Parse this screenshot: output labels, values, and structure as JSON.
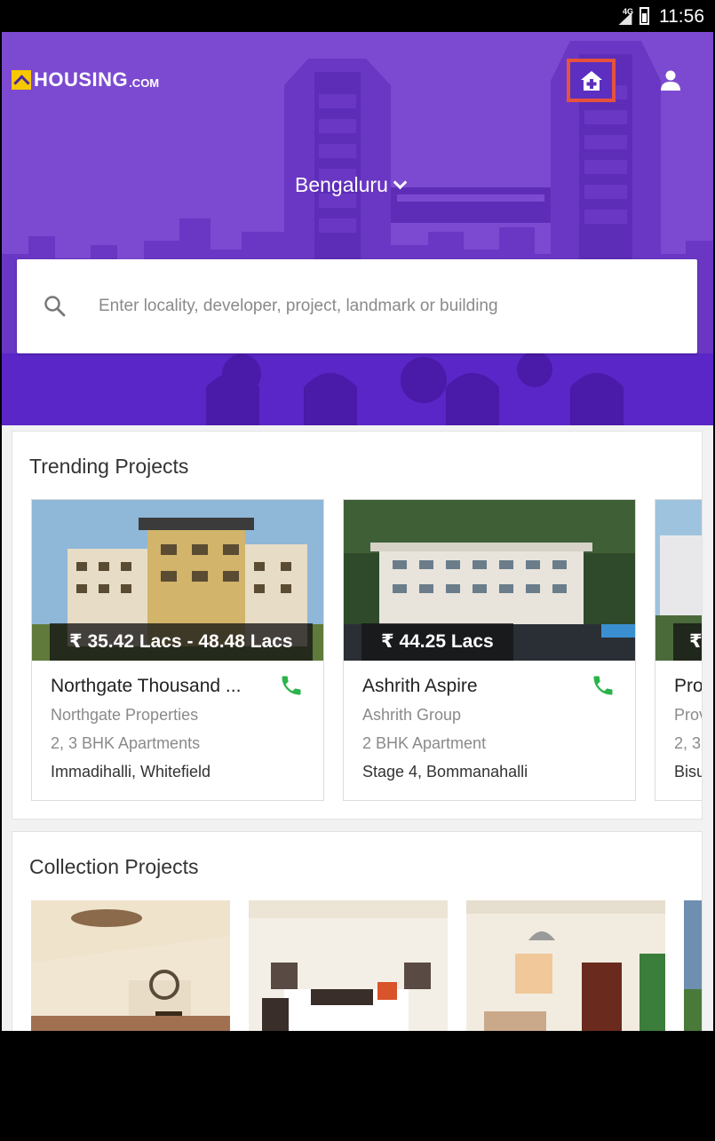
{
  "status_bar": {
    "network": "4G",
    "time": "11:56"
  },
  "header": {
    "logo_text": "HOUSING",
    "logo_domain": ".COM",
    "post_property_icon": "home-plus-icon",
    "account_icon": "person-icon",
    "city": "Bengaluru"
  },
  "search": {
    "placeholder": "Enter locality, developer, project, landmark or building"
  },
  "trending": {
    "title": "Trending Projects",
    "items": [
      {
        "price": "₹ 35.42 Lacs - 48.48 Lacs",
        "name": "Northgate Thousand ...",
        "developer": "Northgate Properties",
        "config": "2, 3 BHK Apartments",
        "location": "Immadihalli, Whitefield"
      },
      {
        "price": "₹ 44.25 Lacs",
        "name": "Ashrith Aspire",
        "developer": "Ashrith Group",
        "config": "2 BHK Apartment",
        "location": "Stage 4, Bommanahalli"
      },
      {
        "price": "₹",
        "name": "Prov",
        "developer": "Prov",
        "config": "2, 3",
        "location": "Bisu"
      }
    ]
  },
  "collection": {
    "title": "Collection Projects"
  },
  "colors": {
    "brand_purple": "#7c4ad1",
    "highlight": "#e5533c",
    "call_green": "#2bb34a",
    "logo_yellow": "#f7c700"
  }
}
